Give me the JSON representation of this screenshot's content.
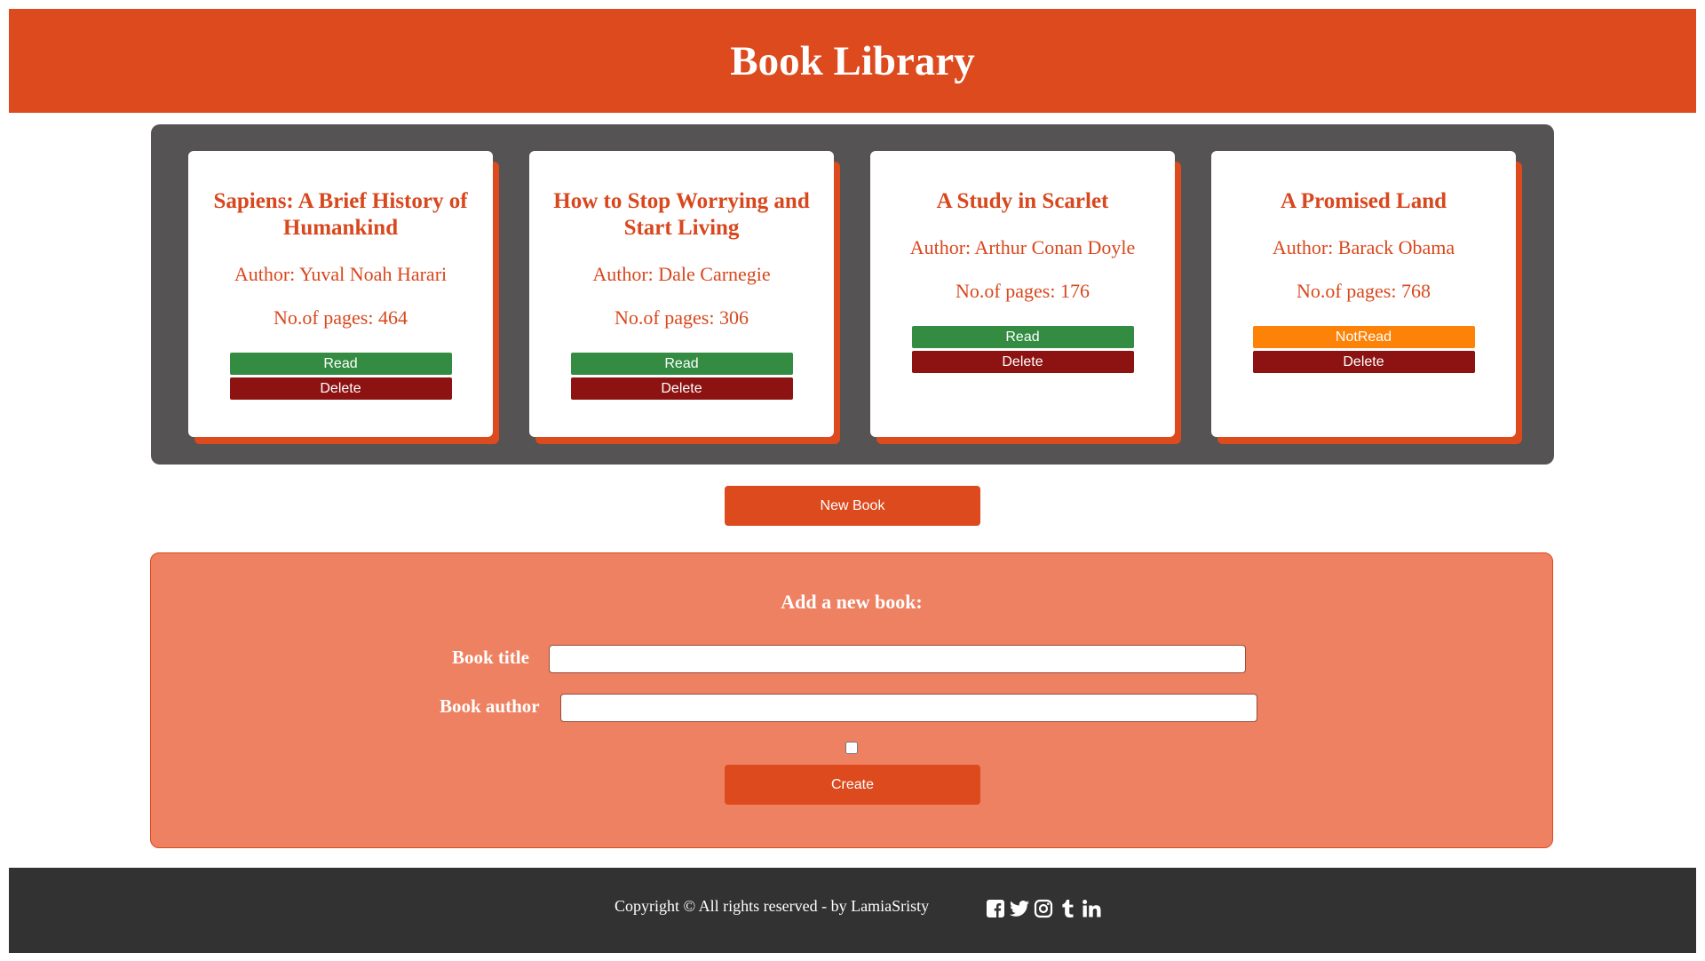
{
  "header": {
    "title": "Book Library"
  },
  "books": [
    {
      "title": "Sapiens: A Brief History of Humankind",
      "author": "Author: Yuval Noah Harari",
      "pages": "No.of pages: 464",
      "status_label": "Read",
      "status": "read",
      "delete_label": "Delete"
    },
    {
      "title": "How to Stop Worrying and Start Living",
      "author": "Author: Dale Carnegie",
      "pages": "No.of pages: 306",
      "status_label": "Read",
      "status": "read",
      "delete_label": "Delete"
    },
    {
      "title": "A Study in Scarlet",
      "author": "Author: Arthur Conan Doyle",
      "pages": "No.of pages: 176",
      "status_label": "Read",
      "status": "read",
      "delete_label": "Delete"
    },
    {
      "title": "A Promised Land",
      "author": "Author: Barack Obama",
      "pages": "No.of pages: 768",
      "status_label": "NotRead",
      "status": "not-read",
      "delete_label": "Delete"
    }
  ],
  "new_book_label": "New Book",
  "form": {
    "heading": "Add a new book:",
    "title_label": "Book title",
    "title_value": "",
    "author_label": "Book author",
    "author_value": "",
    "read_checked": false,
    "create_label": "Create"
  },
  "footer": {
    "copyright": "Copyright © All rights reserved - by LamiaSristy",
    "social_icons": [
      "facebook-icon",
      "twitter-icon",
      "instagram-icon",
      "tumblr-icon",
      "linkedin-icon"
    ]
  },
  "colors": {
    "brand": "#dc4a1e",
    "library_bg": "#555354",
    "form_bg": "#ee8162",
    "read": "#338c42",
    "not_read": "#fd8308",
    "delete": "#8c1312",
    "footer_bg": "#323232"
  }
}
